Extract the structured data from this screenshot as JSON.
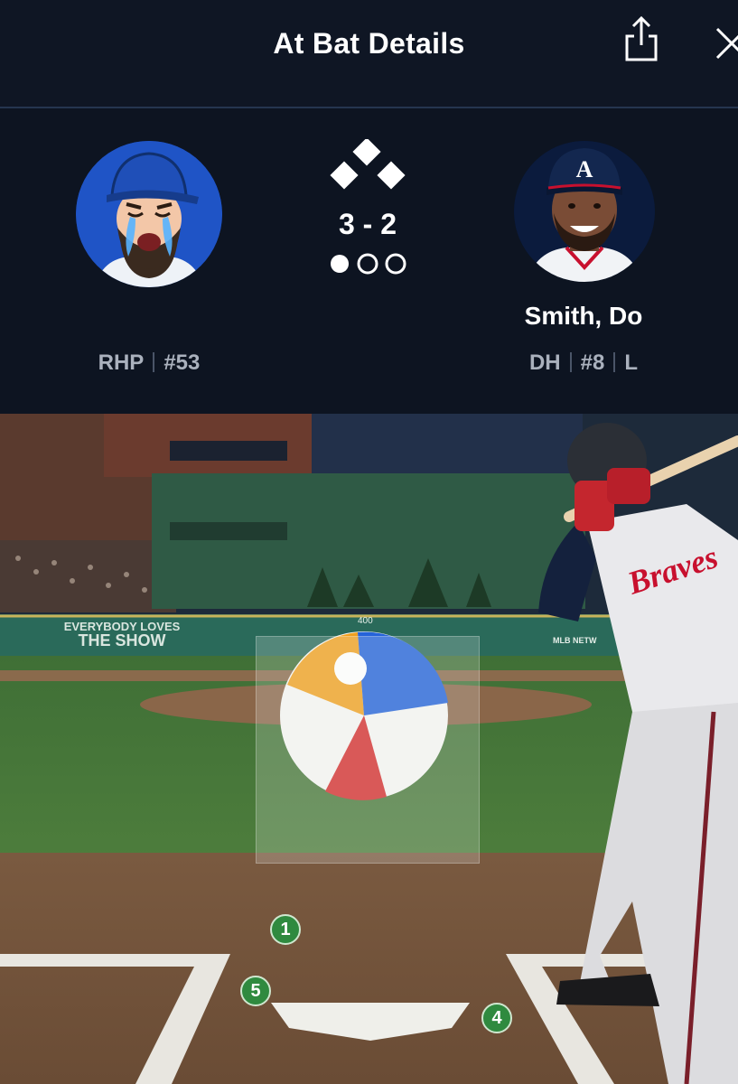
{
  "header": {
    "title": "At Bat Details",
    "share_icon": "share-icon",
    "close_icon": "close-icon"
  },
  "pitcher": {
    "hand": "RHP",
    "number": "#53",
    "avatar_icon": "crying-cartoon-avatar"
  },
  "batter": {
    "name": "Smith, Do",
    "position": "DH",
    "number": "#8",
    "bats": "L",
    "avatar_icon": "player-headshot"
  },
  "game_state": {
    "count": "3 - 2",
    "outs": 1,
    "outs_max": 3,
    "bases_icon": "bases-diamond-icon"
  },
  "field": {
    "wall_text_line1": "EVERYBODY LOVES",
    "wall_text_line2": "THE SHOW",
    "distance_marker": "400",
    "sign_text": "MLB NETW",
    "pitch_markers": [
      {
        "label": "1"
      },
      {
        "label": "5"
      },
      {
        "label": "4"
      }
    ]
  },
  "colors": {
    "background": "#0d1421",
    "muted_text": "#aab1bd",
    "pitch_marker": "#2f8a3f"
  }
}
